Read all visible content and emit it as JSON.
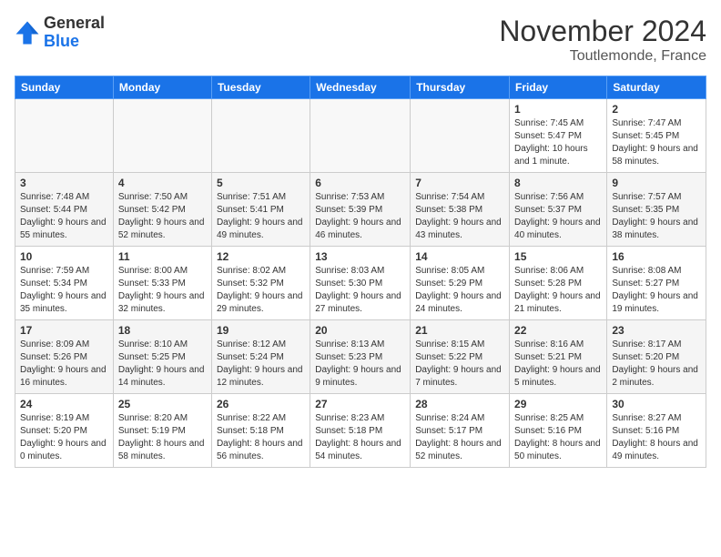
{
  "header": {
    "logo_general": "General",
    "logo_blue": "Blue",
    "month_year": "November 2024",
    "location": "Toutlemonde, France"
  },
  "weekdays": [
    "Sunday",
    "Monday",
    "Tuesday",
    "Wednesday",
    "Thursday",
    "Friday",
    "Saturday"
  ],
  "weeks": [
    [
      {
        "day": "",
        "info": ""
      },
      {
        "day": "",
        "info": ""
      },
      {
        "day": "",
        "info": ""
      },
      {
        "day": "",
        "info": ""
      },
      {
        "day": "",
        "info": ""
      },
      {
        "day": "1",
        "info": "Sunrise: 7:45 AM\nSunset: 5:47 PM\nDaylight: 10 hours and 1 minute."
      },
      {
        "day": "2",
        "info": "Sunrise: 7:47 AM\nSunset: 5:45 PM\nDaylight: 9 hours and 58 minutes."
      }
    ],
    [
      {
        "day": "3",
        "info": "Sunrise: 7:48 AM\nSunset: 5:44 PM\nDaylight: 9 hours and 55 minutes."
      },
      {
        "day": "4",
        "info": "Sunrise: 7:50 AM\nSunset: 5:42 PM\nDaylight: 9 hours and 52 minutes."
      },
      {
        "day": "5",
        "info": "Sunrise: 7:51 AM\nSunset: 5:41 PM\nDaylight: 9 hours and 49 minutes."
      },
      {
        "day": "6",
        "info": "Sunrise: 7:53 AM\nSunset: 5:39 PM\nDaylight: 9 hours and 46 minutes."
      },
      {
        "day": "7",
        "info": "Sunrise: 7:54 AM\nSunset: 5:38 PM\nDaylight: 9 hours and 43 minutes."
      },
      {
        "day": "8",
        "info": "Sunrise: 7:56 AM\nSunset: 5:37 PM\nDaylight: 9 hours and 40 minutes."
      },
      {
        "day": "9",
        "info": "Sunrise: 7:57 AM\nSunset: 5:35 PM\nDaylight: 9 hours and 38 minutes."
      }
    ],
    [
      {
        "day": "10",
        "info": "Sunrise: 7:59 AM\nSunset: 5:34 PM\nDaylight: 9 hours and 35 minutes."
      },
      {
        "day": "11",
        "info": "Sunrise: 8:00 AM\nSunset: 5:33 PM\nDaylight: 9 hours and 32 minutes."
      },
      {
        "day": "12",
        "info": "Sunrise: 8:02 AM\nSunset: 5:32 PM\nDaylight: 9 hours and 29 minutes."
      },
      {
        "day": "13",
        "info": "Sunrise: 8:03 AM\nSunset: 5:30 PM\nDaylight: 9 hours and 27 minutes."
      },
      {
        "day": "14",
        "info": "Sunrise: 8:05 AM\nSunset: 5:29 PM\nDaylight: 9 hours and 24 minutes."
      },
      {
        "day": "15",
        "info": "Sunrise: 8:06 AM\nSunset: 5:28 PM\nDaylight: 9 hours and 21 minutes."
      },
      {
        "day": "16",
        "info": "Sunrise: 8:08 AM\nSunset: 5:27 PM\nDaylight: 9 hours and 19 minutes."
      }
    ],
    [
      {
        "day": "17",
        "info": "Sunrise: 8:09 AM\nSunset: 5:26 PM\nDaylight: 9 hours and 16 minutes."
      },
      {
        "day": "18",
        "info": "Sunrise: 8:10 AM\nSunset: 5:25 PM\nDaylight: 9 hours and 14 minutes."
      },
      {
        "day": "19",
        "info": "Sunrise: 8:12 AM\nSunset: 5:24 PM\nDaylight: 9 hours and 12 minutes."
      },
      {
        "day": "20",
        "info": "Sunrise: 8:13 AM\nSunset: 5:23 PM\nDaylight: 9 hours and 9 minutes."
      },
      {
        "day": "21",
        "info": "Sunrise: 8:15 AM\nSunset: 5:22 PM\nDaylight: 9 hours and 7 minutes."
      },
      {
        "day": "22",
        "info": "Sunrise: 8:16 AM\nSunset: 5:21 PM\nDaylight: 9 hours and 5 minutes."
      },
      {
        "day": "23",
        "info": "Sunrise: 8:17 AM\nSunset: 5:20 PM\nDaylight: 9 hours and 2 minutes."
      }
    ],
    [
      {
        "day": "24",
        "info": "Sunrise: 8:19 AM\nSunset: 5:20 PM\nDaylight: 9 hours and 0 minutes."
      },
      {
        "day": "25",
        "info": "Sunrise: 8:20 AM\nSunset: 5:19 PM\nDaylight: 8 hours and 58 minutes."
      },
      {
        "day": "26",
        "info": "Sunrise: 8:22 AM\nSunset: 5:18 PM\nDaylight: 8 hours and 56 minutes."
      },
      {
        "day": "27",
        "info": "Sunrise: 8:23 AM\nSunset: 5:18 PM\nDaylight: 8 hours and 54 minutes."
      },
      {
        "day": "28",
        "info": "Sunrise: 8:24 AM\nSunset: 5:17 PM\nDaylight: 8 hours and 52 minutes."
      },
      {
        "day": "29",
        "info": "Sunrise: 8:25 AM\nSunset: 5:16 PM\nDaylight: 8 hours and 50 minutes."
      },
      {
        "day": "30",
        "info": "Sunrise: 8:27 AM\nSunset: 5:16 PM\nDaylight: 8 hours and 49 minutes."
      }
    ]
  ]
}
